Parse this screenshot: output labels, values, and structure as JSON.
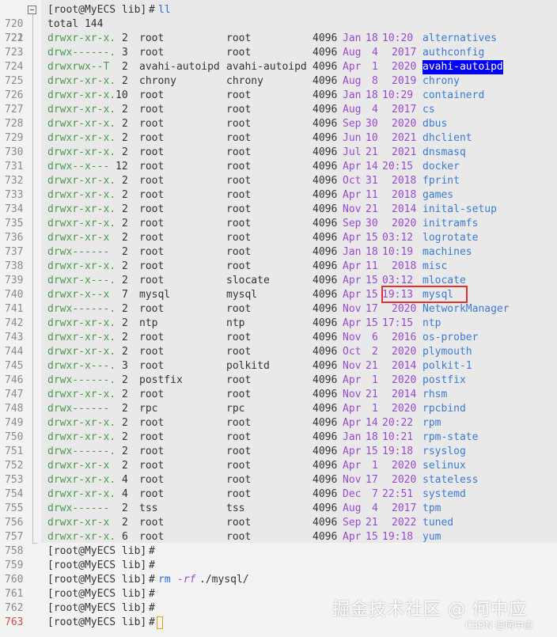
{
  "prompt": "[root@MyECS lib]",
  "hash": "#",
  "first_command": "ll",
  "total_line": "total 144",
  "listing": [
    {
      "ln": "722",
      "perm": "drwxr-xr-x.",
      "links": "2",
      "owner": "root",
      "group": "root",
      "size": "4096",
      "mon": "Jan",
      "day": "18",
      "time": "10:20",
      "name": "alternatives"
    },
    {
      "ln": "723",
      "perm": "drwx------.",
      "links": "3",
      "owner": "root",
      "group": "root",
      "size": "4096",
      "mon": "Aug",
      "day": "4",
      "time": "2017",
      "name": "authconfig"
    },
    {
      "ln": "724",
      "perm": "drwxrwx--T",
      "links": "2",
      "owner": "avahi-autoipd",
      "group": "avahi-autoipd",
      "size": "4096",
      "mon": "Apr",
      "day": "1",
      "time": "2020",
      "name": "avahi-autoipd"
    },
    {
      "ln": "725",
      "perm": "drwxr-xr-x.",
      "links": "2",
      "owner": "chrony",
      "group": "chrony",
      "size": "4096",
      "mon": "Aug",
      "day": "8",
      "time": "2019",
      "name": "chrony"
    },
    {
      "ln": "726",
      "perm": "drwxr-xr-x.",
      "links": "10",
      "owner": "root",
      "group": "root",
      "size": "4096",
      "mon": "Jan",
      "day": "18",
      "time": "10:29",
      "name": "containerd"
    },
    {
      "ln": "727",
      "perm": "drwxr-xr-x.",
      "links": "2",
      "owner": "root",
      "group": "root",
      "size": "4096",
      "mon": "Aug",
      "day": "4",
      "time": "2017",
      "name": "cs"
    },
    {
      "ln": "728",
      "perm": "drwxr-xr-x.",
      "links": "2",
      "owner": "root",
      "group": "root",
      "size": "4096",
      "mon": "Sep",
      "day": "30",
      "time": "2020",
      "name": "dbus"
    },
    {
      "ln": "729",
      "perm": "drwxr-xr-x.",
      "links": "2",
      "owner": "root",
      "group": "root",
      "size": "4096",
      "mon": "Jun",
      "day": "10",
      "time": "2021",
      "name": "dhclient"
    },
    {
      "ln": "730",
      "perm": "drwxr-xr-x.",
      "links": "2",
      "owner": "root",
      "group": "root",
      "size": "4096",
      "mon": "Jul",
      "day": "21",
      "time": "2021",
      "name": "dnsmasq"
    },
    {
      "ln": "731",
      "perm": "drwx--x---",
      "links": "12",
      "owner": "root",
      "group": "root",
      "size": "4096",
      "mon": "Apr",
      "day": "14",
      "time": "20:15",
      "name": "docker"
    },
    {
      "ln": "732",
      "perm": "drwxr-xr-x.",
      "links": "2",
      "owner": "root",
      "group": "root",
      "size": "4096",
      "mon": "Oct",
      "day": "31",
      "time": "2018",
      "name": "fprint"
    },
    {
      "ln": "733",
      "perm": "drwxr-xr-x.",
      "links": "2",
      "owner": "root",
      "group": "root",
      "size": "4096",
      "mon": "Apr",
      "day": "11",
      "time": "2018",
      "name": "games"
    },
    {
      "ln": "734",
      "perm": "drwxr-xr-x.",
      "links": "2",
      "owner": "root",
      "group": "root",
      "size": "4096",
      "mon": "Nov",
      "day": "21",
      "time": "2014",
      "name": "inital-setup"
    },
    {
      "ln": "735",
      "perm": "drwxr-xr-x.",
      "links": "2",
      "owner": "root",
      "group": "root",
      "size": "4096",
      "mon": "Sep",
      "day": "30",
      "time": "2020",
      "name": "initramfs"
    },
    {
      "ln": "736",
      "perm": "drwxr-xr-x",
      "links": "2",
      "owner": "root",
      "group": "root",
      "size": "4096",
      "mon": "Apr",
      "day": "15",
      "time": "03:12",
      "name": "logrotate"
    },
    {
      "ln": "737",
      "perm": "drwx------",
      "links": "2",
      "owner": "root",
      "group": "root",
      "size": "4096",
      "mon": "Jan",
      "day": "18",
      "time": "10:19",
      "name": "machines"
    },
    {
      "ln": "738",
      "perm": "drwxr-xr-x.",
      "links": "2",
      "owner": "root",
      "group": "root",
      "size": "4096",
      "mon": "Apr",
      "day": "11",
      "time": "2018",
      "name": "misc"
    },
    {
      "ln": "739",
      "perm": "drwxr-x---.",
      "links": "2",
      "owner": "root",
      "group": "slocate",
      "size": "4096",
      "mon": "Apr",
      "day": "15",
      "time": "03:12",
      "name": "mlocate"
    },
    {
      "ln": "740",
      "perm": "drwxr-x--x",
      "links": "7",
      "owner": "mysql",
      "group": "mysql",
      "size": "4096",
      "mon": "Apr",
      "day": "15",
      "time": "19:13",
      "name": "mysql"
    },
    {
      "ln": "741",
      "perm": "drwx------.",
      "links": "2",
      "owner": "root",
      "group": "root",
      "size": "4096",
      "mon": "Nov",
      "day": "17",
      "time": "2020",
      "name": "NetworkManager"
    },
    {
      "ln": "742",
      "perm": "drwxr-xr-x.",
      "links": "2",
      "owner": "ntp",
      "group": "ntp",
      "size": "4096",
      "mon": "Apr",
      "day": "15",
      "time": "17:15",
      "name": "ntp"
    },
    {
      "ln": "743",
      "perm": "drwxr-xr-x.",
      "links": "2",
      "owner": "root",
      "group": "root",
      "size": "4096",
      "mon": "Nov",
      "day": "6",
      "time": "2016",
      "name": "os-prober"
    },
    {
      "ln": "744",
      "perm": "drwxr-xr-x.",
      "links": "2",
      "owner": "root",
      "group": "root",
      "size": "4096",
      "mon": "Oct",
      "day": "2",
      "time": "2020",
      "name": "plymouth"
    },
    {
      "ln": "745",
      "perm": "drwxr-x---.",
      "links": "3",
      "owner": "root",
      "group": "polkitd",
      "size": "4096",
      "mon": "Nov",
      "day": "21",
      "time": "2014",
      "name": "polkit-1"
    },
    {
      "ln": "746",
      "perm": "drwx------.",
      "links": "2",
      "owner": "postfix",
      "group": "root",
      "size": "4096",
      "mon": "Apr",
      "day": "1",
      "time": "2020",
      "name": "postfix"
    },
    {
      "ln": "747",
      "perm": "drwxr-xr-x.",
      "links": "2",
      "owner": "root",
      "group": "root",
      "size": "4096",
      "mon": "Nov",
      "day": "21",
      "time": "2014",
      "name": "rhsm"
    },
    {
      "ln": "748",
      "perm": "drwx------",
      "links": "2",
      "owner": "rpc",
      "group": "rpc",
      "size": "4096",
      "mon": "Apr",
      "day": "1",
      "time": "2020",
      "name": "rpcbind"
    },
    {
      "ln": "749",
      "perm": "drwxr-xr-x.",
      "links": "2",
      "owner": "root",
      "group": "root",
      "size": "4096",
      "mon": "Apr",
      "day": "14",
      "time": "20:22",
      "name": "rpm"
    },
    {
      "ln": "750",
      "perm": "drwxr-xr-x.",
      "links": "2",
      "owner": "root",
      "group": "root",
      "size": "4096",
      "mon": "Jan",
      "day": "18",
      "time": "10:21",
      "name": "rpm-state"
    },
    {
      "ln": "751",
      "perm": "drwx------.",
      "links": "2",
      "owner": "root",
      "group": "root",
      "size": "4096",
      "mon": "Apr",
      "day": "15",
      "time": "19:18",
      "name": "rsyslog"
    },
    {
      "ln": "752",
      "perm": "drwxr-xr-x",
      "links": "2",
      "owner": "root",
      "group": "root",
      "size": "4096",
      "mon": "Apr",
      "day": "1",
      "time": "2020",
      "name": "selinux"
    },
    {
      "ln": "753",
      "perm": "drwxr-xr-x.",
      "links": "4",
      "owner": "root",
      "group": "root",
      "size": "4096",
      "mon": "Nov",
      "day": "17",
      "time": "2020",
      "name": "stateless"
    },
    {
      "ln": "754",
      "perm": "drwxr-xr-x.",
      "links": "4",
      "owner": "root",
      "group": "root",
      "size": "4096",
      "mon": "Dec",
      "day": "7",
      "time": "22:51",
      "name": "systemd"
    },
    {
      "ln": "755",
      "perm": "drwx------",
      "links": "2",
      "owner": "tss",
      "group": "tss",
      "size": "4096",
      "mon": "Aug",
      "day": "4",
      "time": "2017",
      "name": "tpm"
    },
    {
      "ln": "756",
      "perm": "drwxr-xr-x",
      "links": "2",
      "owner": "root",
      "group": "root",
      "size": "4096",
      "mon": "Sep",
      "day": "21",
      "time": "2022",
      "name": "tuned"
    },
    {
      "ln": "757",
      "perm": "drwxr-xr-x.",
      "links": "6",
      "owner": "root",
      "group": "root",
      "size": "4096",
      "mon": "Apr",
      "day": "15",
      "time": "19:18",
      "name": "yum"
    }
  ],
  "line_numbers": {
    "first": "720",
    "total": "721",
    "after": [
      "758",
      "759",
      "760",
      "761",
      "762",
      "763"
    ]
  },
  "rm_command": {
    "cmd": "rm",
    "flag": "-rf",
    "path": "./mysql/"
  },
  "watermark_main": "掘金技术社区 @ 何中应",
  "watermark_csdn": "CSDN @何中应",
  "colors": {
    "highlight_box": "#e03030",
    "selected_bg": "#0000ff"
  }
}
